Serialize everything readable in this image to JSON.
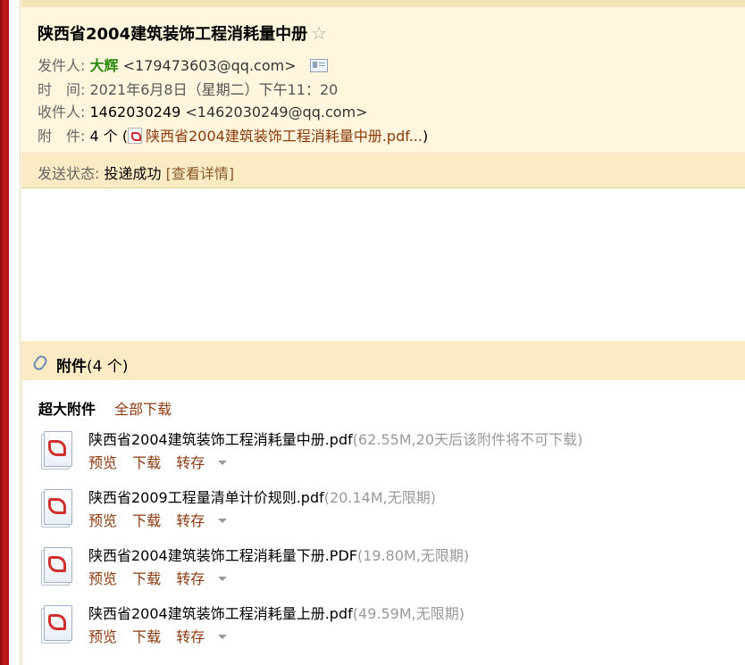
{
  "email": {
    "subject": "陕西省2004建筑装饰工程消耗量中册",
    "star_icon": "☆",
    "from_label": "发件人:",
    "from_name": "大辉",
    "from_addr": "<179473603@qq.com>",
    "time_label": "时　间:",
    "time_value": "2021年6月8日（星期二）下午11：20",
    "to_label": "收件人:",
    "to_name": "1462030249",
    "to_addr": "<1462030249@qq.com>",
    "attach_label": "附　件:",
    "attach_count": "4 个",
    "attach_open": "(",
    "attach_first": "陕西省2004建筑装饰工程消耗量中册.pdf...",
    "attach_close": ")",
    "status_label": "发送状态:",
    "status_value": "投递成功",
    "status_detail": "[查看详情]"
  },
  "attachments": {
    "title": "附件",
    "count": "(4 个)",
    "section_label": "超大附件",
    "download_all": "全部下载",
    "files": [
      {
        "name": "陕西省2004建筑装饰工程消耗量中册.pdf",
        "meta": "(62.55M,20天后该附件将不可下载)"
      },
      {
        "name": "陕西省2009工程量清单计价规则.pdf",
        "meta": "(20.14M,无限期)"
      },
      {
        "name": "陕西省2004建筑装饰工程消耗量下册.PDF",
        "meta": "(19.80M,无限期)"
      },
      {
        "name": "陕西省2004建筑装饰工程消耗量上册.pdf",
        "meta": "(49.59M,无限期)"
      }
    ],
    "actions": {
      "preview": "预览",
      "download": "下载",
      "save": "转存"
    }
  },
  "icons": {
    "attachment": "paperclip-icon",
    "file": "pdf-file-icon",
    "contact": "contact-card-icon"
  }
}
